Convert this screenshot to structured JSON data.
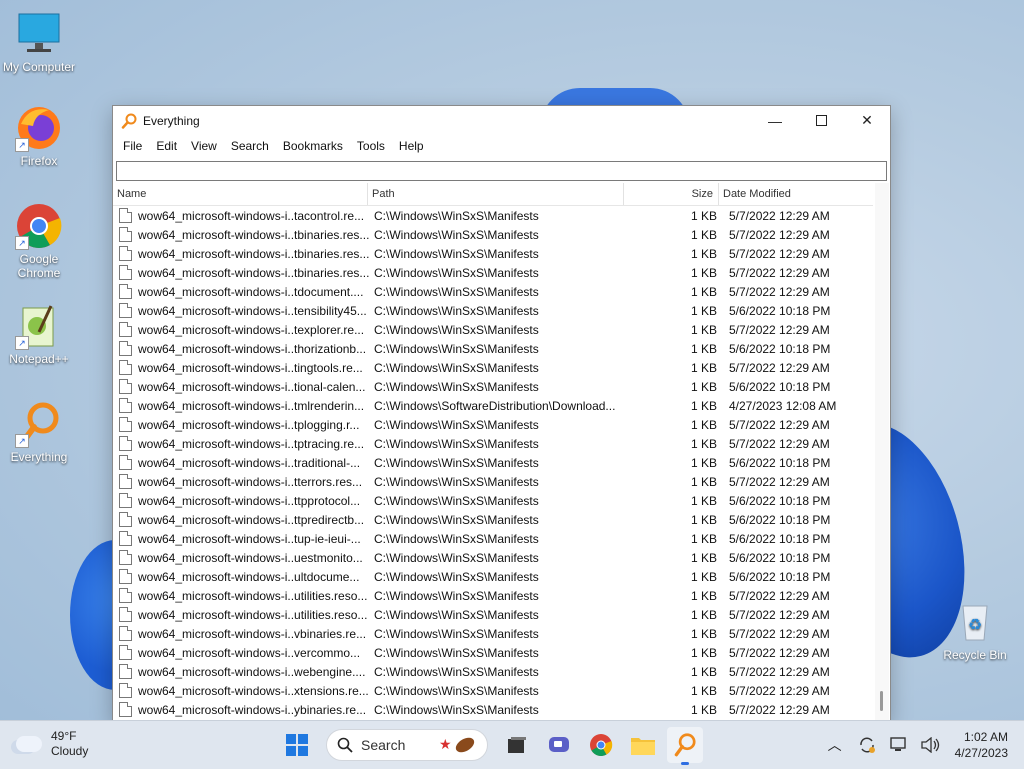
{
  "desktop": {
    "icons": [
      {
        "label": "My Computer"
      },
      {
        "label": "Firefox"
      },
      {
        "label": "Google Chrome"
      },
      {
        "label": "Notepad++"
      },
      {
        "label": "Everything"
      },
      {
        "label": "Recycle Bin"
      }
    ]
  },
  "window": {
    "title": "Everything",
    "menu": [
      "File",
      "Edit",
      "View",
      "Search",
      "Bookmarks",
      "Tools",
      "Help"
    ],
    "search_value": "",
    "columns": {
      "name": "Name",
      "path": "Path",
      "size": "Size",
      "date": "Date Modified"
    },
    "rows": [
      {
        "name": "wow64_microsoft-windows-i..tacontrol.re...",
        "path": "C:\\Windows\\WinSxS\\Manifests",
        "size": "1 KB",
        "date": "5/7/2022 12:29 AM"
      },
      {
        "name": "wow64_microsoft-windows-i..tbinaries.res...",
        "path": "C:\\Windows\\WinSxS\\Manifests",
        "size": "1 KB",
        "date": "5/7/2022 12:29 AM"
      },
      {
        "name": "wow64_microsoft-windows-i..tbinaries.res...",
        "path": "C:\\Windows\\WinSxS\\Manifests",
        "size": "1 KB",
        "date": "5/7/2022 12:29 AM"
      },
      {
        "name": "wow64_microsoft-windows-i..tbinaries.res...",
        "path": "C:\\Windows\\WinSxS\\Manifests",
        "size": "1 KB",
        "date": "5/7/2022 12:29 AM"
      },
      {
        "name": "wow64_microsoft-windows-i..tdocument....",
        "path": "C:\\Windows\\WinSxS\\Manifests",
        "size": "1 KB",
        "date": "5/7/2022 12:29 AM"
      },
      {
        "name": "wow64_microsoft-windows-i..tensibility45...",
        "path": "C:\\Windows\\WinSxS\\Manifests",
        "size": "1 KB",
        "date": "5/6/2022 10:18 PM"
      },
      {
        "name": "wow64_microsoft-windows-i..texplorer.re...",
        "path": "C:\\Windows\\WinSxS\\Manifests",
        "size": "1 KB",
        "date": "5/7/2022 12:29 AM"
      },
      {
        "name": "wow64_microsoft-windows-i..thorizationb...",
        "path": "C:\\Windows\\WinSxS\\Manifests",
        "size": "1 KB",
        "date": "5/6/2022 10:18 PM"
      },
      {
        "name": "wow64_microsoft-windows-i..tingtools.re...",
        "path": "C:\\Windows\\WinSxS\\Manifests",
        "size": "1 KB",
        "date": "5/7/2022 12:29 AM"
      },
      {
        "name": "wow64_microsoft-windows-i..tional-calen...",
        "path": "C:\\Windows\\WinSxS\\Manifests",
        "size": "1 KB",
        "date": "5/6/2022 10:18 PM"
      },
      {
        "name": "wow64_microsoft-windows-i..tmlrenderin...",
        "path": "C:\\Windows\\SoftwareDistribution\\Download...",
        "size": "1 KB",
        "date": "4/27/2023 12:08 AM"
      },
      {
        "name": "wow64_microsoft-windows-i..tplogging.r...",
        "path": "C:\\Windows\\WinSxS\\Manifests",
        "size": "1 KB",
        "date": "5/7/2022 12:29 AM"
      },
      {
        "name": "wow64_microsoft-windows-i..tptracing.re...",
        "path": "C:\\Windows\\WinSxS\\Manifests",
        "size": "1 KB",
        "date": "5/7/2022 12:29 AM"
      },
      {
        "name": "wow64_microsoft-windows-i..traditional-...",
        "path": "C:\\Windows\\WinSxS\\Manifests",
        "size": "1 KB",
        "date": "5/6/2022 10:18 PM"
      },
      {
        "name": "wow64_microsoft-windows-i..tterrors.res...",
        "path": "C:\\Windows\\WinSxS\\Manifests",
        "size": "1 KB",
        "date": "5/7/2022 12:29 AM"
      },
      {
        "name": "wow64_microsoft-windows-i..ttpprotocol...",
        "path": "C:\\Windows\\WinSxS\\Manifests",
        "size": "1 KB",
        "date": "5/6/2022 10:18 PM"
      },
      {
        "name": "wow64_microsoft-windows-i..ttpredirectb...",
        "path": "C:\\Windows\\WinSxS\\Manifests",
        "size": "1 KB",
        "date": "5/6/2022 10:18 PM"
      },
      {
        "name": "wow64_microsoft-windows-i..tup-ie-ieui-...",
        "path": "C:\\Windows\\WinSxS\\Manifests",
        "size": "1 KB",
        "date": "5/6/2022 10:18 PM"
      },
      {
        "name": "wow64_microsoft-windows-i..uestmonito...",
        "path": "C:\\Windows\\WinSxS\\Manifests",
        "size": "1 KB",
        "date": "5/6/2022 10:18 PM"
      },
      {
        "name": "wow64_microsoft-windows-i..ultdocume...",
        "path": "C:\\Windows\\WinSxS\\Manifests",
        "size": "1 KB",
        "date": "5/6/2022 10:18 PM"
      },
      {
        "name": "wow64_microsoft-windows-i..utilities.reso...",
        "path": "C:\\Windows\\WinSxS\\Manifests",
        "size": "1 KB",
        "date": "5/7/2022 12:29 AM"
      },
      {
        "name": "wow64_microsoft-windows-i..utilities.reso...",
        "path": "C:\\Windows\\WinSxS\\Manifests",
        "size": "1 KB",
        "date": "5/7/2022 12:29 AM"
      },
      {
        "name": "wow64_microsoft-windows-i..vbinaries.re...",
        "path": "C:\\Windows\\WinSxS\\Manifests",
        "size": "1 KB",
        "date": "5/7/2022 12:29 AM"
      },
      {
        "name": "wow64_microsoft-windows-i..vercommo...",
        "path": "C:\\Windows\\WinSxS\\Manifests",
        "size": "1 KB",
        "date": "5/7/2022 12:29 AM"
      },
      {
        "name": "wow64_microsoft-windows-i..webengine....",
        "path": "C:\\Windows\\WinSxS\\Manifests",
        "size": "1 KB",
        "date": "5/7/2022 12:29 AM"
      },
      {
        "name": "wow64_microsoft-windows-i..xtensions.re...",
        "path": "C:\\Windows\\WinSxS\\Manifests",
        "size": "1 KB",
        "date": "5/7/2022 12:29 AM"
      },
      {
        "name": "wow64_microsoft-windows-i..ybinaries.re...",
        "path": "C:\\Windows\\WinSxS\\Manifests",
        "size": "1 KB",
        "date": "5/7/2022 12:29 AM"
      }
    ]
  },
  "taskbar": {
    "weather_temp": "49°F",
    "weather_desc": "Cloudy",
    "search_label": "Search",
    "time": "1:02 AM",
    "date": "4/27/2023"
  },
  "colors": {
    "accent": "#2f6ee2",
    "everything_orange": "#f08a1c"
  }
}
